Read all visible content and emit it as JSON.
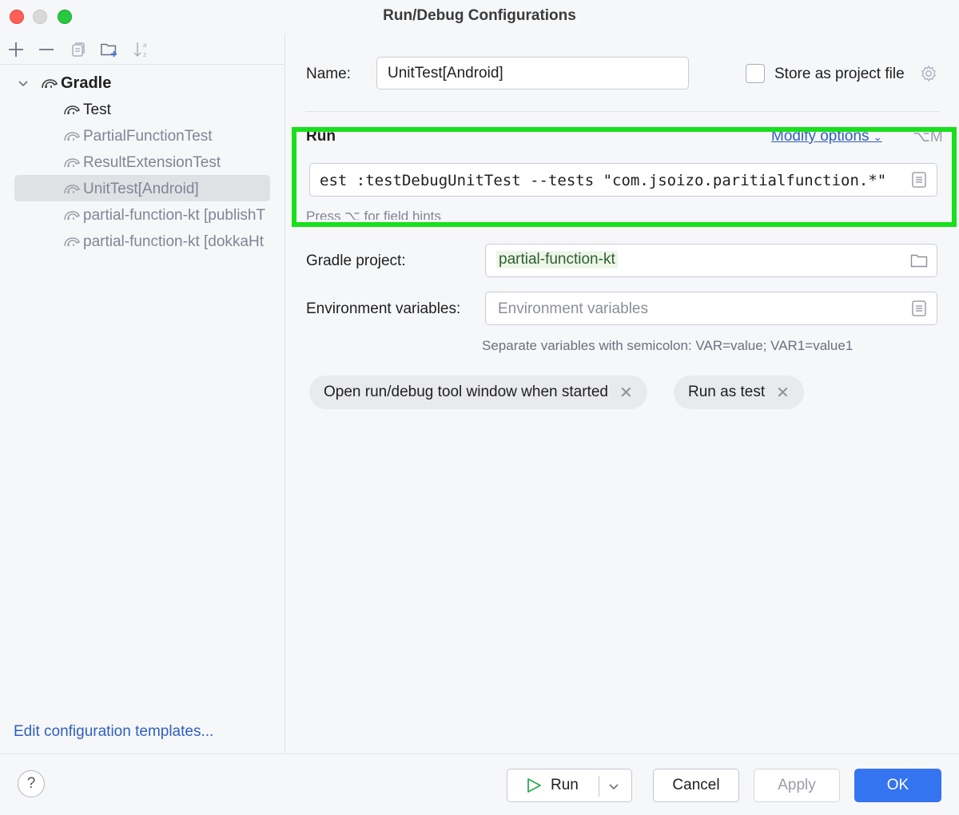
{
  "window": {
    "title": "Run/Debug Configurations"
  },
  "toolbar": {
    "icons": [
      "add-icon",
      "remove-icon",
      "copy-icon",
      "new-folder-icon",
      "sort-icon"
    ]
  },
  "tree": {
    "group": "Gradle",
    "items": [
      {
        "label": "Test"
      },
      {
        "label": "PartialFunctionTest"
      },
      {
        "label": "ResultExtensionTest"
      },
      {
        "label": "UnitTest[Android]"
      },
      {
        "label": "partial-function-kt [publishT"
      },
      {
        "label": "partial-function-kt [dokkaHt"
      }
    ],
    "edit_templates": "Edit configuration templates..."
  },
  "form": {
    "name_label": "Name:",
    "name_value": "UnitTest[Android]",
    "store_label": "Store as project file",
    "run_section": "Run",
    "modify_options": "Modify options",
    "modify_shortcut": "⌥M",
    "command_value": "est :testDebugUnitTest --tests \"com.jsoizo.paritialfunction.*\"",
    "field_hint": "Press ⌥ for field hints",
    "gradle_project_label": "Gradle project:",
    "gradle_project_value": "partial-function-kt",
    "env_label": "Environment variables:",
    "env_placeholder": "Environment variables",
    "env_note": "Separate variables with semicolon: VAR=value; VAR1=value1",
    "chips": [
      {
        "label": "Open run/debug tool window when started"
      },
      {
        "label": "Run as test"
      }
    ]
  },
  "buttons": {
    "help": "?",
    "run": "Run",
    "cancel": "Cancel",
    "apply": "Apply",
    "ok": "OK"
  },
  "colors": {
    "accent": "#3574f0",
    "link": "#2f5fbf",
    "highlight": "#18e01c"
  }
}
